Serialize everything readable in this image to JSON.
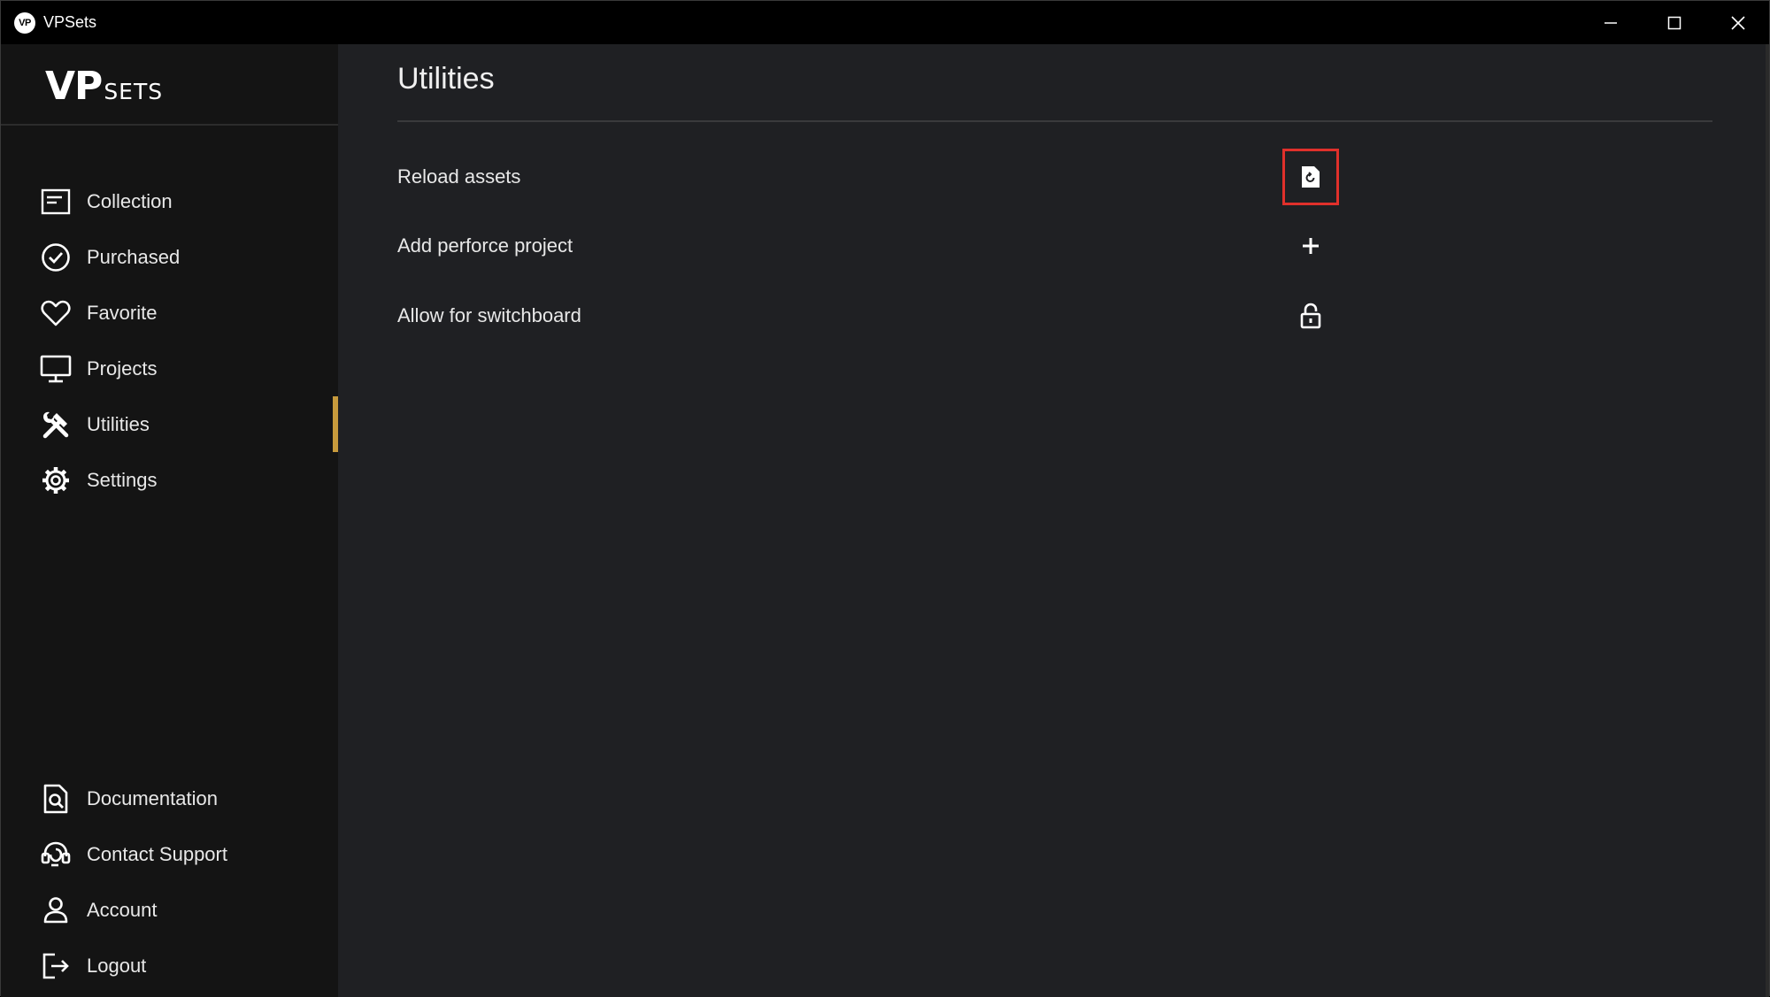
{
  "window": {
    "title": "VPSets",
    "badge": "VP"
  },
  "brand": {
    "vp": "VP",
    "sets": "SETS"
  },
  "sidebar": {
    "items": [
      {
        "label": "Collection",
        "icon": "collection-icon",
        "active": false
      },
      {
        "label": "Purchased",
        "icon": "check-circle-icon",
        "active": false
      },
      {
        "label": "Favorite",
        "icon": "heart-icon",
        "active": false
      },
      {
        "label": "Projects",
        "icon": "monitor-icon",
        "active": false
      },
      {
        "label": "Utilities",
        "icon": "tools-icon",
        "active": true
      },
      {
        "label": "Settings",
        "icon": "gear-icon",
        "active": false
      }
    ],
    "bottom_items": [
      {
        "label": "Documentation",
        "icon": "document-search-icon"
      },
      {
        "label": "Contact Support",
        "icon": "headset-icon"
      },
      {
        "label": "Account",
        "icon": "user-icon"
      },
      {
        "label": "Logout",
        "icon": "logout-icon"
      }
    ],
    "accent_color": "#c79a3c"
  },
  "main": {
    "title": "Utilities",
    "rows": [
      {
        "label": "Reload assets",
        "action_icon": "reload-file-icon",
        "focused": true
      },
      {
        "label": "Add perforce project",
        "action_icon": "plus-icon",
        "focused": false
      },
      {
        "label": "Allow for switchboard",
        "action_icon": "unlock-icon",
        "focused": false
      }
    ]
  },
  "colors": {
    "focus_outline": "#e0302b"
  }
}
